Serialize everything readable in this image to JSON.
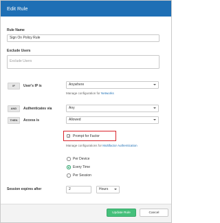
{
  "dialog": {
    "title": "Edit Rule"
  },
  "form": {
    "rule_name": {
      "label": "Rule Name",
      "value": "Sign On Policy Rule"
    },
    "exclude_users": {
      "label": "Exclude Users",
      "placeholder": "Exclude Users"
    },
    "ip_row": {
      "tag": "IF",
      "label": "User's IP is",
      "selected": "Anywhere",
      "manage_text": "Manage configuration for",
      "manage_link": "Networks"
    },
    "auth_row": {
      "tag": "AND",
      "label": "Authenticates via",
      "selected": "Any"
    },
    "access_row": {
      "tag": "THEN",
      "label": "Access is",
      "selected": "Allowed"
    },
    "prompt_factor": {
      "label": "Prompt for Factor",
      "checked": true
    },
    "mfa_manage": {
      "text": "Manage configurations for",
      "link": "Multifactor Authentication"
    },
    "frequency": {
      "options": [
        "Per Device",
        "Every Time",
        "Per Session"
      ],
      "selected": "Every Time"
    },
    "session": {
      "label": "Session expires after",
      "value": "2",
      "unit": "Hours"
    }
  },
  "footer": {
    "update_label": "Update Rule",
    "cancel_label": "Cancel"
  },
  "colors": {
    "header": "#1e6fb5",
    "primary_button": "#45c07b",
    "highlight": "#d9222a"
  }
}
